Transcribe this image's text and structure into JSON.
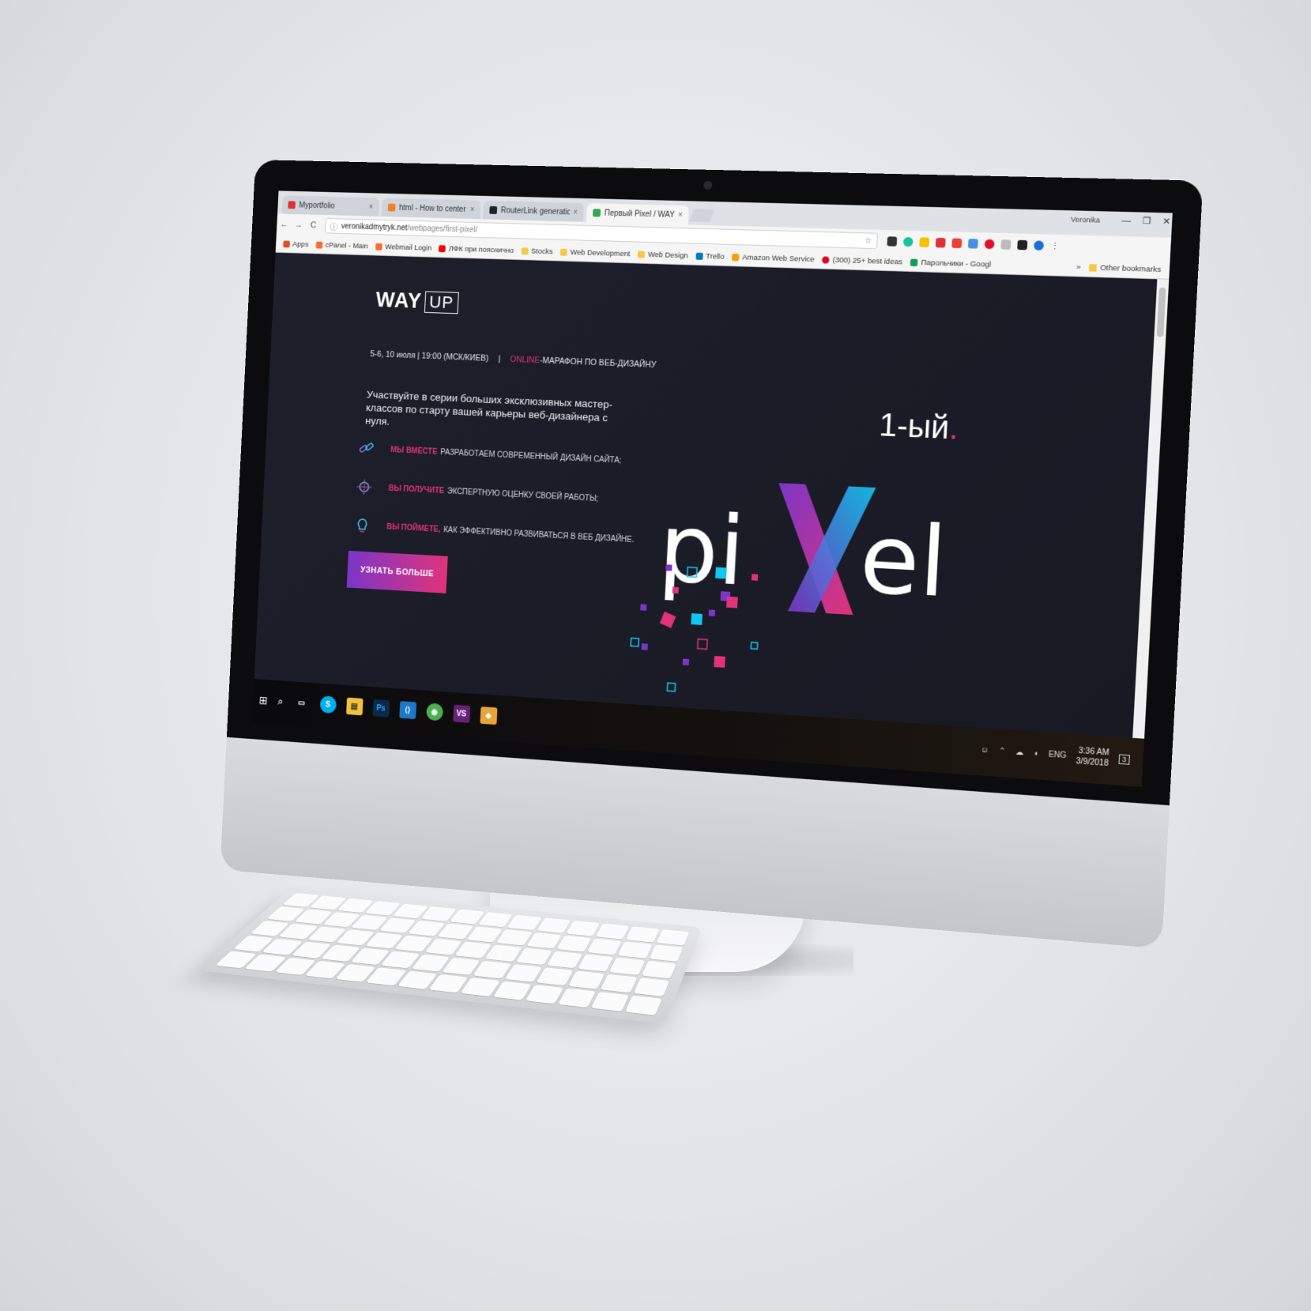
{
  "browser": {
    "tabs": [
      {
        "label": "Myportfolio",
        "favicon": "angular-icon",
        "color": "#dd3333",
        "active": false
      },
      {
        "label": "html - How to center a",
        "favicon": "stackoverflow-icon",
        "color": "#f48024",
        "active": false
      },
      {
        "label": "RouterLink generation th",
        "favicon": "github-icon",
        "color": "#222222",
        "active": false
      },
      {
        "label": "Первый Pixel / WAYUP",
        "favicon": "wayup-icon",
        "color": "#2fa84f",
        "active": true
      }
    ],
    "close_glyph": "×",
    "user_name": "Veronika",
    "window_controls": {
      "minimize": "—",
      "maximize": "❐",
      "close": "✕"
    },
    "nav": {
      "back": "←",
      "forward": "→",
      "reload": "C"
    },
    "url": {
      "host": "veronikadmytryk.net",
      "path": "/webpages/first-pixel/"
    },
    "bookmarks": [
      {
        "label": "Apps",
        "color": "#e34c26"
      },
      {
        "label": "cPanel - Main",
        "color": "#ff6c2c"
      },
      {
        "label": "Webmail Login",
        "color": "#ff6c2c"
      },
      {
        "label": "ЛФК при пояснично",
        "color": "#ff0000"
      },
      {
        "label": "Stocks",
        "color": "#f7c844"
      },
      {
        "label": "Web Development",
        "color": "#f7c844"
      },
      {
        "label": "Web Design",
        "color": "#f7c844"
      },
      {
        "label": "Trello",
        "color": "#0079bf"
      },
      {
        "label": "Amazon Web Service",
        "color": "#ff9900"
      },
      {
        "label": "(300) 25+ best ideas",
        "color": "#e60023"
      },
      {
        "label": "Парольчики - Googl",
        "color": "#0f9d58"
      }
    ],
    "more_bookmarks": "»",
    "other_bookmarks": "Other bookmarks"
  },
  "page": {
    "logo": {
      "word": "WAY",
      "box": "UP"
    },
    "event": {
      "dates": "5-6, 10 июля | 19:00 (МСК/КИЕВ)",
      "separator": "|",
      "online": "ONLINE",
      "marathon": "-МАРАФОН ПО ВЕБ-ДИЗАЙНУ"
    },
    "intro": "Участвуйте в серии больших эксклюзивных мастер-классов по старту вашей карьеры веб-дизайнера с нуля.",
    "features": [
      {
        "highlight": "МЫ ВМЕСТЕ",
        "text": "РАЗРАБОТАЕМ СОВРЕМЕННЫЙ ДИЗАЙН САЙТА;",
        "icon": "link-icon"
      },
      {
        "highlight": "ВЫ ПОЛУЧИТЕ",
        "text": "ЭКСПЕРТНУЮ ОЦЕНКУ СВОЕЙ РАБОТЫ;",
        "icon": "target-icon"
      },
      {
        "highlight": "ВЫ ПОЙМЕТЕ,",
        "text": "КАК ЭФФЕКТИВНО РАЗВИВАТЬСЯ В ВЕБ ДИЗАЙНЕ.",
        "icon": "lightbulb-icon"
      }
    ],
    "cta": "УЗНАТЬ БОЛЬШЕ",
    "hero": {
      "ordinal": "1-ый",
      "ordinal_dot": ".",
      "word_left": "pi",
      "word_x": "X",
      "word_right": "el"
    }
  },
  "taskbar": {
    "start": "⊞",
    "search": "⌕",
    "apps": [
      {
        "name": "task-view",
        "label": "▭",
        "color": "transparent"
      },
      {
        "name": "skype",
        "label": "S",
        "color": "#00aff0"
      },
      {
        "name": "file-explorer",
        "label": "▤",
        "color": "#f3c13a"
      },
      {
        "name": "photoshop",
        "label": "Ps",
        "color": "#0a2a4a"
      },
      {
        "name": "vscode",
        "label": "⟨⟩",
        "color": "#1e78c8"
      },
      {
        "name": "chrome",
        "label": "◉",
        "color": "#4caf50"
      },
      {
        "name": "visual-studio",
        "label": "VS",
        "color": "#68217a"
      },
      {
        "name": "sketch-app",
        "label": "◆",
        "color": "#e8a33a"
      }
    ],
    "tray": {
      "language": "ENG",
      "time": "3:36 AM",
      "date": "3/9/2018",
      "notifications": "3"
    }
  },
  "colors": {
    "accent_pink": "#e0337a",
    "accent_purple": "#7b36c7",
    "accent_cyan": "#12c6f2",
    "page_bg": "#1b1c26"
  }
}
